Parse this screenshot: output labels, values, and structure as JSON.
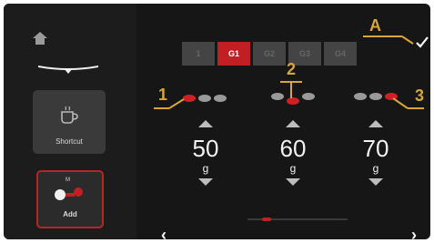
{
  "sidebar": {
    "shortcut_label": "Shortcut",
    "add_label": "Add",
    "add_badge": "M"
  },
  "tabs": [
    {
      "label": "1",
      "active": false
    },
    {
      "label": "G1",
      "active": true
    },
    {
      "label": "G2",
      "active": false
    },
    {
      "label": "G3",
      "active": false
    },
    {
      "label": "G4",
      "active": false
    }
  ],
  "callouts": {
    "a": "A",
    "one": "1",
    "two": "2",
    "three": "3"
  },
  "columns": [
    {
      "value": "50",
      "unit": "g"
    },
    {
      "value": "60",
      "unit": "g"
    },
    {
      "value": "70",
      "unit": "g"
    }
  ],
  "nav": {
    "prev": "‹",
    "next": "›"
  },
  "colors": {
    "accent": "#c21f24",
    "callout": "#d9a53b",
    "panel": "#161616"
  }
}
